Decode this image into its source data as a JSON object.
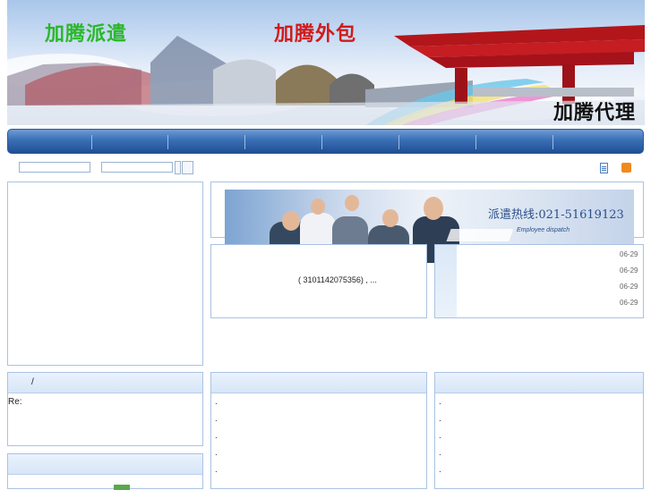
{
  "banner": {
    "title_dispatch": "加腾派遣",
    "title_outsourcing": "加腾外包",
    "title_agency": "加腾代理"
  },
  "nav": {
    "items": [
      "",
      "",
      "",
      "",
      "",
      "",
      "",
      ""
    ]
  },
  "toolbar": {
    "doc_icon": "document-icon",
    "rss_icon": "rss-icon",
    "rss_glyph": ")"
  },
  "hero": {
    "hotline": "派遣热线:021-51619123",
    "subtitle": "Employee dispatch"
  },
  "notice": {
    "text": "( 3101142075356)   ,    ..."
  },
  "news": {
    "dates": [
      "06-29",
      "06-29",
      "06-29",
      "06-29"
    ]
  },
  "left_panel": {
    "header": "/",
    "item": "Re:"
  },
  "middle_panel": {
    "bullets": [
      ".",
      ".",
      ".",
      ".",
      "."
    ]
  },
  "right_panel": {
    "bullets": [
      ".",
      ".",
      ".",
      ".",
      "."
    ]
  },
  "colors": {
    "nav": "#2f62a8",
    "panel_border": "#a9c3e3",
    "dispatch_green": "#2ab82a",
    "outsourcing_red": "#d21a1a"
  }
}
